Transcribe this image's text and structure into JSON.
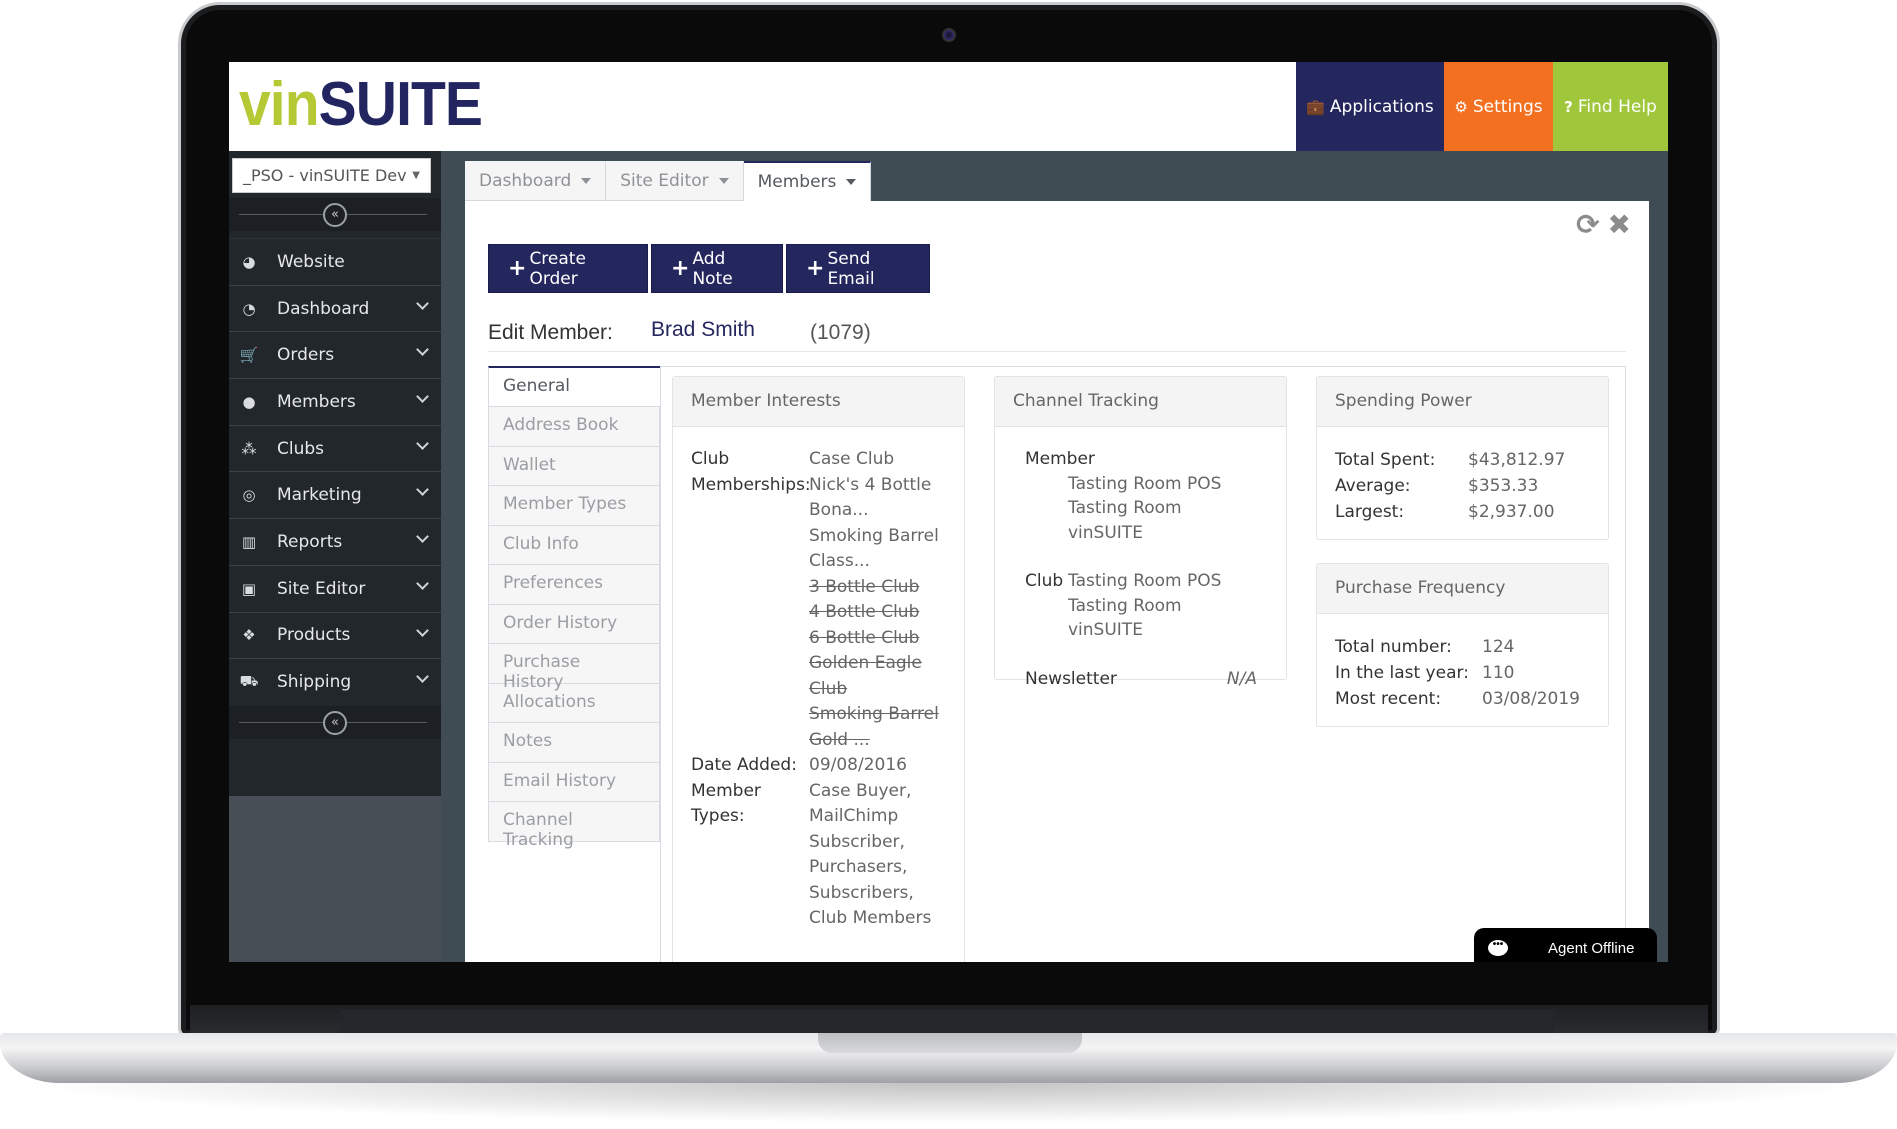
{
  "header": {
    "logo_vin": "vin",
    "logo_suite": "SUITE",
    "buttons": [
      {
        "label": "Applications",
        "icon": "briefcase-icon",
        "glyph": "💼",
        "color": "#24265e"
      },
      {
        "label": "Settings",
        "icon": "gear-icon",
        "glyph": "⚙",
        "color": "#f37021"
      },
      {
        "label": "Find Help",
        "icon": "question-icon",
        "glyph": "?",
        "color": "#a0c73b"
      }
    ]
  },
  "sidebar": {
    "site_select": "_PSO - vinSUITE Dev",
    "collapse_glyph": "«",
    "items": [
      {
        "label": "Website",
        "icon": "globe-icon",
        "glyph": "◕",
        "has_chevron": false
      },
      {
        "label": "Dashboard",
        "icon": "dashboard-icon",
        "glyph": "◔",
        "has_chevron": true
      },
      {
        "label": "Orders",
        "icon": "cart-icon",
        "glyph": "🛒",
        "has_chevron": true
      },
      {
        "label": "Members",
        "icon": "user-icon",
        "glyph": "●",
        "has_chevron": true
      },
      {
        "label": "Clubs",
        "icon": "users-icon",
        "glyph": "⁂",
        "has_chevron": true
      },
      {
        "label": "Marketing",
        "icon": "target-icon",
        "glyph": "◎",
        "has_chevron": true
      },
      {
        "label": "Reports",
        "icon": "bar-chart-icon",
        "glyph": "▥",
        "has_chevron": true
      },
      {
        "label": "Site Editor",
        "icon": "image-icon",
        "glyph": "▣",
        "has_chevron": true
      },
      {
        "label": "Products",
        "icon": "cubes-icon",
        "glyph": "❖",
        "has_chevron": true
      },
      {
        "label": "Shipping",
        "icon": "truck-icon",
        "glyph": "⛟",
        "has_chevron": true
      }
    ]
  },
  "tabs": [
    {
      "label": "Dashboard",
      "active": false
    },
    {
      "label": "Site Editor",
      "active": false
    },
    {
      "label": "Members",
      "active": true
    }
  ],
  "toolbar": {
    "refresh_glyph": "⟳",
    "close_glyph": "✖"
  },
  "actions": [
    {
      "label": "Create Order"
    },
    {
      "label": "Add Note"
    },
    {
      "label": "Send Email"
    }
  ],
  "edit_member": {
    "label": "Edit Member:",
    "name": "Brad Smith",
    "id": "(1079)"
  },
  "vertical_tabs": [
    "General",
    "Address Book",
    "Wallet",
    "Member Types",
    "Club Info",
    "Preferences",
    "Order History",
    "Purchase History",
    "Allocations",
    "Notes",
    "Email History",
    "Channel Tracking"
  ],
  "member_interests": {
    "title": "Member Interests",
    "club_label_1": "Club",
    "club_label_2": "Memberships:",
    "clubs": [
      {
        "name": "Case Club",
        "active": true
      },
      {
        "name": "Nick's 4 Bottle Bona...",
        "active": true
      },
      {
        "name": "Smoking Barrel Class...",
        "active": true
      },
      {
        "name": "3 Bottle Club",
        "active": false
      },
      {
        "name": "4 Bottle Club",
        "active": false
      },
      {
        "name": "6 Bottle Club",
        "active": false
      },
      {
        "name": "Golden Eagle Club",
        "active": false
      },
      {
        "name": "Smoking Barrel Gold ...",
        "active": false
      }
    ],
    "date_label": "Date Added:",
    "date_value": "09/08/2016",
    "types_label": "Member Types:",
    "types_value": "Case Buyer, MailChimp Subscriber, Purchasers, Subscribers, Club Members"
  },
  "channel_tracking": {
    "title": "Channel Tracking",
    "member_label": "Member",
    "member_values": [
      "Tasting Room POS",
      "Tasting Room vinSUITE"
    ],
    "club_label": "Club",
    "club_values": [
      "Tasting Room POS",
      "Tasting Room vinSUITE"
    ],
    "newsletter_label": "Newsletter",
    "newsletter_value": "N/A"
  },
  "spending_power": {
    "title": "Spending Power",
    "rows": [
      {
        "label": "Total Spent:",
        "value": "$43,812.97"
      },
      {
        "label": "Average:",
        "value": "$353.33"
      },
      {
        "label": "Largest:",
        "value": "$2,937.00"
      }
    ]
  },
  "purchase_frequency": {
    "title": "Purchase Frequency",
    "rows": [
      {
        "label": "Total number:",
        "value": "124"
      },
      {
        "label": "In the last year:",
        "value": "110"
      },
      {
        "label": "Most recent:",
        "value": "03/08/2019"
      }
    ]
  },
  "chat": {
    "label": "Agent Offline",
    "glyph": "•••"
  }
}
